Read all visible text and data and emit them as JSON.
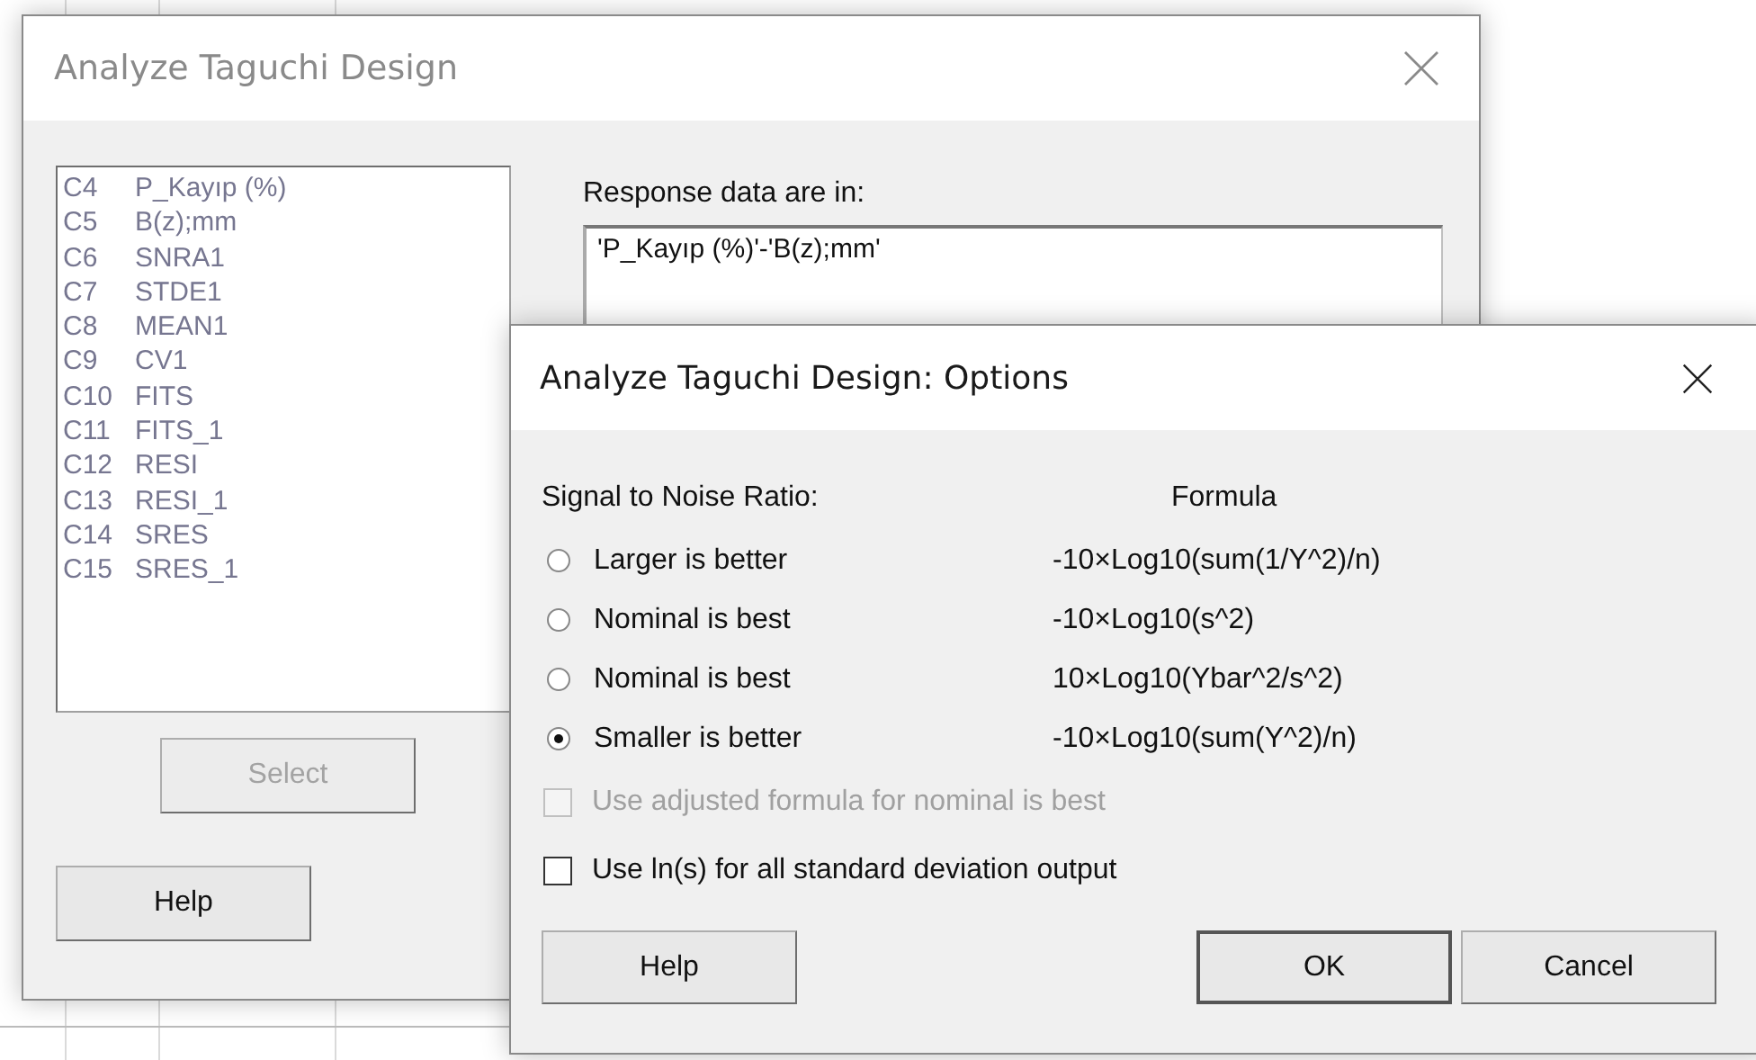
{
  "main_window": {
    "title": "Analyze Taguchi Design",
    "active": false,
    "columns": [
      {
        "id": "C4",
        "name": "P_Kayıp (%)"
      },
      {
        "id": "C5",
        "name": "B(z);mm"
      },
      {
        "id": "C6",
        "name": "SNRA1"
      },
      {
        "id": "C7",
        "name": "STDE1"
      },
      {
        "id": "C8",
        "name": "MEAN1"
      },
      {
        "id": "C9",
        "name": "CV1"
      },
      {
        "id": "C10",
        "name": "FITS"
      },
      {
        "id": "C11",
        "name": "FITS_1"
      },
      {
        "id": "C12",
        "name": "RESI"
      },
      {
        "id": "C13",
        "name": "RESI_1"
      },
      {
        "id": "C14",
        "name": "SRES"
      },
      {
        "id": "C15",
        "name": "SRES_1"
      }
    ],
    "select_button": {
      "label": "Select",
      "disabled": true
    },
    "help_button": {
      "label": "Help"
    },
    "response_label": "Response data are in:",
    "response_value": "'P_Kayıp (%)'-'B(z);mm'"
  },
  "options_window": {
    "title": "Analyze Taguchi Design: Options",
    "active": true,
    "ratio_heading": "Signal to Noise Ratio:",
    "formula_heading": "Formula",
    "ratios": [
      {
        "label": "Larger is better",
        "formula": "-10×Log10(sum(1/Y^2)/n)",
        "selected": false
      },
      {
        "label": "Nominal is best",
        "formula": "-10×Log10(s^2)",
        "selected": false
      },
      {
        "label": "Nominal is best",
        "formula": "10×Log10(Ybar^2/s^2)",
        "selected": false
      },
      {
        "label": "Smaller is better",
        "formula": "-10×Log10(sum(Y^2)/n)",
        "selected": true
      }
    ],
    "checkboxes": [
      {
        "label": "Use adjusted formula for nominal is best",
        "checked": false,
        "disabled": true
      },
      {
        "label": "Use ln(s) for all standard deviation output",
        "checked": false,
        "disabled": false
      }
    ],
    "buttons": [
      {
        "label": "Help",
        "kind": "help"
      },
      {
        "label": "OK",
        "kind": "default"
      },
      {
        "label": "Cancel",
        "kind": "cancel"
      }
    ]
  }
}
